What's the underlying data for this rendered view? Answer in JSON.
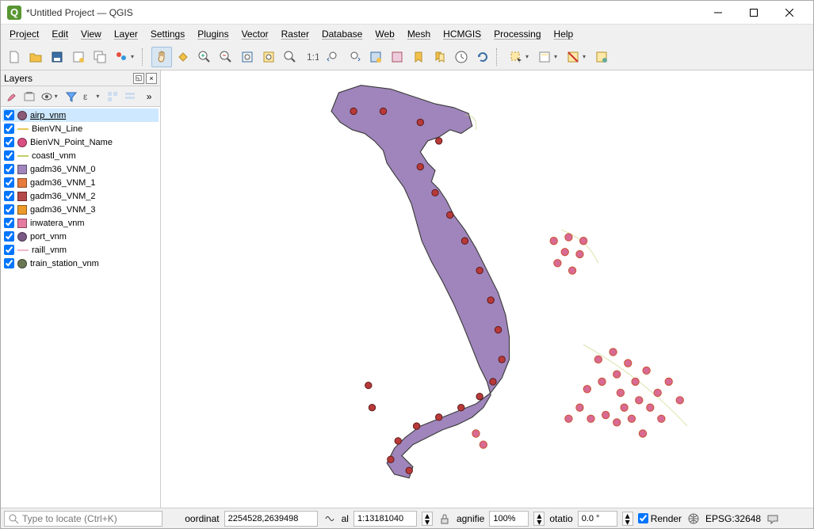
{
  "title": "*Untitled Project — QGIS",
  "menus": [
    "Project",
    "Edit",
    "View",
    "Layer",
    "Settings",
    "Plugins",
    "Vector",
    "Raster",
    "Database",
    "Web",
    "Mesh",
    "HCMGIS",
    "Processing",
    "Help"
  ],
  "panel": {
    "title": "Layers"
  },
  "layers": [
    {
      "name": "airp_vnm",
      "checked": true,
      "sel": true,
      "shape": "circle",
      "color": "#8a5a77",
      "underline": true
    },
    {
      "name": "BienVN_Line",
      "checked": true,
      "shape": "line",
      "color": "#e6c65a"
    },
    {
      "name": "BienVN_Point_Name",
      "checked": true,
      "shape": "circle",
      "color": "#d94f82"
    },
    {
      "name": "coastl_vnm",
      "checked": true,
      "shape": "line",
      "color": "#c3cd6a"
    },
    {
      "name": "gadm36_VNM_0",
      "checked": true,
      "shape": "square",
      "color": "#9f85bb"
    },
    {
      "name": "gadm36_VNM_1",
      "checked": true,
      "shape": "square",
      "color": "#e77b3c"
    },
    {
      "name": "gadm36_VNM_2",
      "checked": true,
      "shape": "square",
      "color": "#b44a4a"
    },
    {
      "name": "gadm36_VNM_3",
      "checked": true,
      "shape": "square",
      "color": "#ec9a29"
    },
    {
      "name": "inwatera_vnm",
      "checked": true,
      "shape": "square",
      "color": "#e57ba0"
    },
    {
      "name": "port_vnm",
      "checked": true,
      "shape": "circle",
      "color": "#7a5a85"
    },
    {
      "name": "raill_vnm",
      "checked": true,
      "shape": "line",
      "color": "#f0b8c8"
    },
    {
      "name": "train_station_vnm",
      "checked": true,
      "shape": "circle",
      "color": "#6a7753"
    }
  ],
  "status": {
    "locate_placeholder": "Type to locate (Ctrl+K)",
    "coord_label": "oordinat",
    "coord_value": "2254528,2639498",
    "scale_label": "al",
    "scale_value": "1:13181040",
    "magnifier_label": "agnifie",
    "magnifier_value": "100%",
    "rotation_label": "otatio",
    "rotation_value": "0.0 °",
    "render_label": "Render",
    "render_checked": true,
    "crs": "EPSG:32648"
  },
  "map": {
    "fill": "#9f85bb",
    "stroke": "#3a3a3a",
    "coast": "#c3cd6a",
    "airp_color": "#b73939",
    "point_color": "#d96a93",
    "point_stroke": "#c74f2a"
  }
}
